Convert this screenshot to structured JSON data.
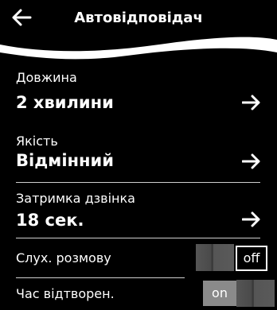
{
  "header": {
    "title": "Автовідповідач"
  },
  "settings": [
    {
      "label": "Довжина",
      "value": "2 хвилини"
    },
    {
      "label": "Якість",
      "value": "Відмінний"
    },
    {
      "label": "Затримка дзвінка",
      "value": "18 сек."
    }
  ],
  "toggles": [
    {
      "label": "Слух. розмову",
      "state": "off"
    },
    {
      "label": "Час відтворен.",
      "state": "on"
    }
  ],
  "colors": {
    "background": "#000000",
    "text": "#ffffff",
    "toggle_on": "#8a8a8a"
  }
}
